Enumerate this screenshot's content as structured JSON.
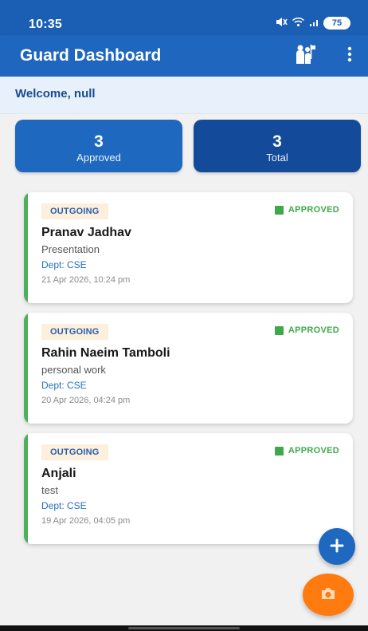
{
  "status_bar": {
    "time": "10:35",
    "battery": "75"
  },
  "app_bar": {
    "title": "Guard Dashboard",
    "actions": [
      "guard-icon",
      "more-vert-icon"
    ]
  },
  "welcome": {
    "text": "Welcome, null"
  },
  "summary": {
    "approved": {
      "value": "3",
      "label": "Approved"
    },
    "total": {
      "value": "3",
      "label": "Total"
    }
  },
  "requests": [
    {
      "direction": "OUTGOING",
      "status": "APPROVED",
      "name": "Pranav Jadhav",
      "reason": "Presentation",
      "department": "Dept: CSE",
      "timestamp": "21 Apr 2026, 10:24 pm"
    },
    {
      "direction": "OUTGOING",
      "status": "APPROVED",
      "name": "Rahin Naeim Tamboli",
      "reason": "personal work",
      "department": "Dept: CSE",
      "timestamp": "20 Apr 2026, 04:24 pm"
    },
    {
      "direction": "OUTGOING",
      "status": "APPROVED",
      "name": "Anjali",
      "reason": "test",
      "department": "Dept: CSE",
      "timestamp": "19 Apr 2026, 04:05 pm"
    }
  ],
  "actions": {
    "add_icon": "plus-icon",
    "camera_icon": "camera-icon"
  },
  "colors": {
    "primary": "#1f66be",
    "dark_primary": "#134a9a",
    "approved": "#3fa84b",
    "accent": "#ff7a0f"
  }
}
